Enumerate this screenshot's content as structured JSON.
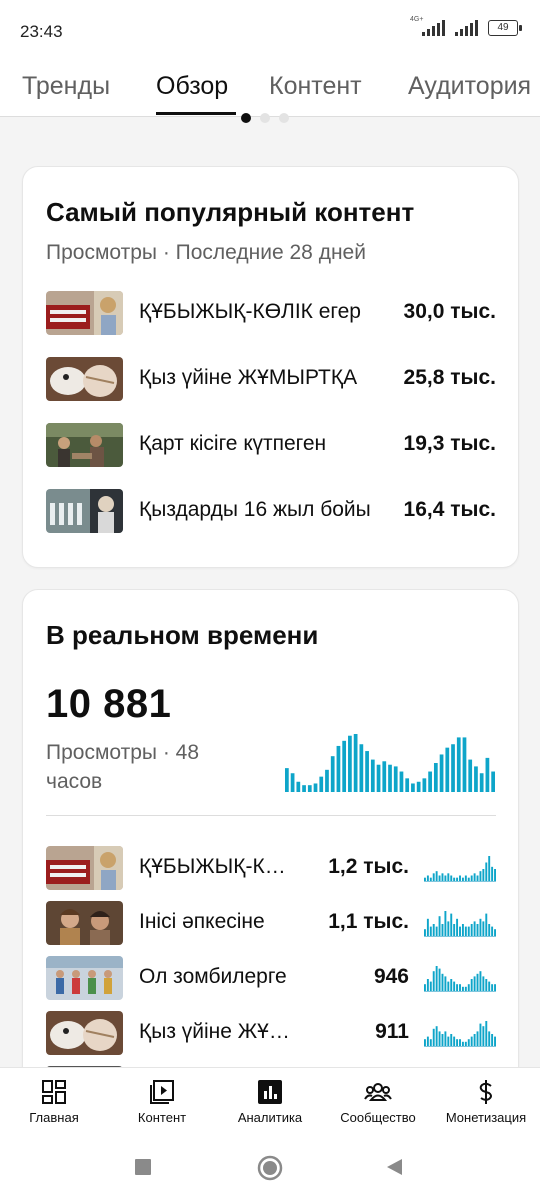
{
  "status": {
    "time": "23:43",
    "network_tag": "4G+",
    "battery": "49"
  },
  "tabs": [
    {
      "label": "Тренды",
      "active": false
    },
    {
      "label": "Обзор",
      "active": true
    },
    {
      "label": "Контент",
      "active": false
    },
    {
      "label": "Аудитория",
      "active": false
    }
  ],
  "popular": {
    "title": "Самый популярный контент",
    "subtitle": "Просмотры · Последние 28 дней",
    "items": [
      {
        "title": "ҚҰБЫЖЫҚ-КӨЛІК егер",
        "views": "30,0 тыс."
      },
      {
        "title": "Қыз үйіне ЖҰМЫРТҚА",
        "views": "25,8 тыс."
      },
      {
        "title": "Қарт кісіге күтпеген",
        "views": "19,3 тыс."
      },
      {
        "title": "Қыздарды 16 жыл бойы",
        "views": "16,4 тыс."
      }
    ]
  },
  "realtime": {
    "title": "В реальном времени",
    "total": "10 881",
    "views_label": "Просмотры · 48 часов",
    "chart_values": [
      14,
      11,
      6,
      4,
      4,
      5,
      9,
      13,
      21,
      27,
      30,
      33,
      34,
      28,
      24,
      19,
      16,
      18,
      16,
      15,
      12,
      8,
      5,
      6,
      8,
      12,
      17,
      22,
      26,
      28,
      32,
      32,
      19,
      15,
      11,
      20,
      12
    ],
    "items": [
      {
        "title": "ҚҰБЫЖЫҚ-КӨЛІК",
        "views": "1,2 тыс.",
        "spark": [
          2,
          3,
          2,
          4,
          5,
          3,
          4,
          3,
          4,
          3,
          2,
          2,
          3,
          2,
          3,
          2,
          3,
          4,
          3,
          5,
          6,
          9,
          12,
          7,
          6
        ]
      },
      {
        "title": "Інісі әпкесіне",
        "views": "1,1 тыс.",
        "spark": [
          3,
          7,
          4,
          5,
          4,
          8,
          5,
          10,
          6,
          9,
          5,
          7,
          4,
          5,
          4,
          4,
          5,
          6,
          5,
          7,
          6,
          9,
          5,
          4,
          3
        ]
      },
      {
        "title": "Ол зомбилерге",
        "views": "946",
        "spark": [
          3,
          5,
          4,
          8,
          10,
          9,
          7,
          6,
          4,
          5,
          4,
          3,
          3,
          2,
          2,
          3,
          5,
          6,
          7,
          8,
          6,
          5,
          4,
          3,
          3
        ]
      },
      {
        "title": "Қыз үйіне ЖҰМЫРТҚА",
        "views": "911",
        "spark": [
          3,
          4,
          3,
          7,
          8,
          6,
          5,
          6,
          4,
          5,
          4,
          3,
          3,
          2,
          2,
          3,
          4,
          5,
          6,
          9,
          8,
          10,
          6,
          5,
          4
        ]
      }
    ]
  },
  "nav": [
    {
      "label": "Главная",
      "icon": "dashboard-icon"
    },
    {
      "label": "Контент",
      "icon": "content-play-icon"
    },
    {
      "label": "Аналитика",
      "icon": "analytics-icon"
    },
    {
      "label": "Сообщество",
      "icon": "community-icon"
    },
    {
      "label": "Монетизация",
      "icon": "dollar-icon"
    }
  ],
  "colors": {
    "accent": "#065fd4",
    "chart": "#0ea5c9",
    "text": "#0f0f0f",
    "secondary": "#606060"
  }
}
